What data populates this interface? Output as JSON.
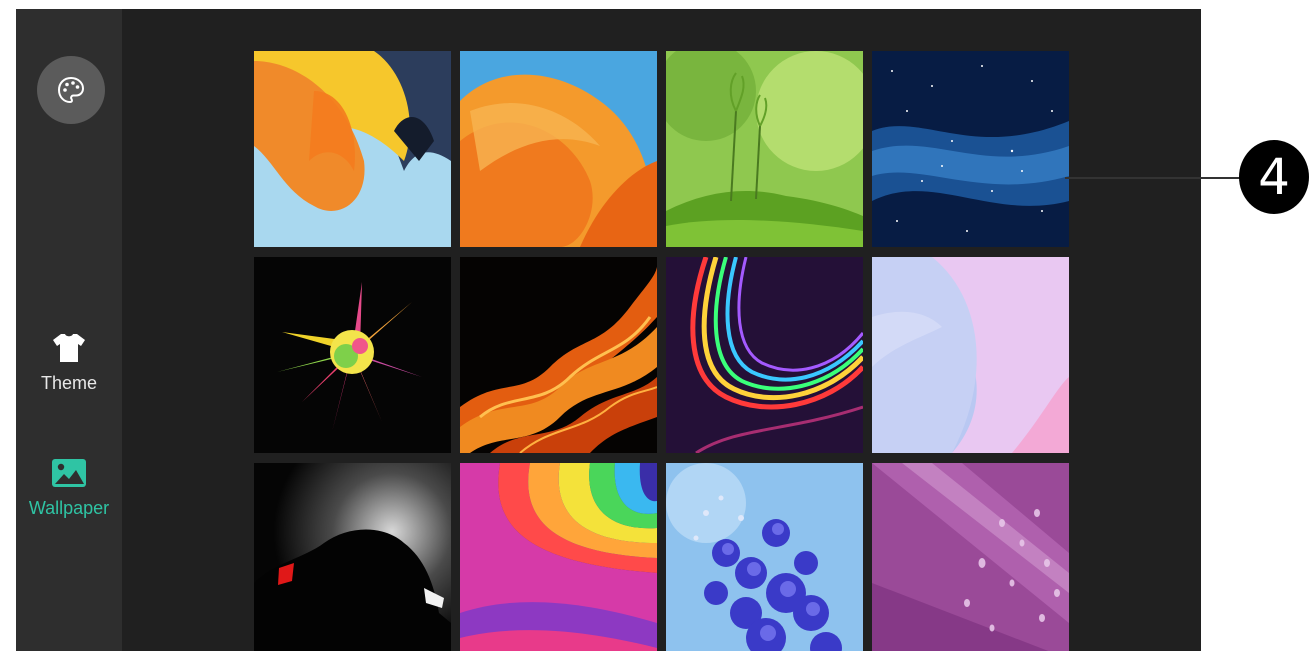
{
  "sidebar": {
    "palette_button": {
      "icon": "palette-icon"
    },
    "items": [
      {
        "label": "Theme",
        "icon": "tshirt-icon",
        "active": false
      },
      {
        "label": "Wallpaper",
        "icon": "image-icon",
        "active": true,
        "color": "#2fc4a4"
      }
    ]
  },
  "wallpapers": [
    {
      "name": "wallpaper-orange-yellow-fold",
      "row": 1,
      "col": 1
    },
    {
      "name": "wallpaper-orange-petals",
      "row": 1,
      "col": 2
    },
    {
      "name": "wallpaper-green-sprouts",
      "row": 1,
      "col": 3
    },
    {
      "name": "wallpaper-blue-starfield",
      "row": 1,
      "col": 4
    },
    {
      "name": "wallpaper-color-powder-burst",
      "row": 2,
      "col": 1
    },
    {
      "name": "wallpaper-flames",
      "row": 2,
      "col": 2
    },
    {
      "name": "wallpaper-light-streaks",
      "row": 2,
      "col": 3
    },
    {
      "name": "wallpaper-pastel-curves",
      "row": 2,
      "col": 4
    },
    {
      "name": "wallpaper-dark-car-silhouette",
      "row": 3,
      "col": 1
    },
    {
      "name": "wallpaper-rainbow-waves",
      "row": 3,
      "col": 2
    },
    {
      "name": "wallpaper-blue-flowers",
      "row": 3,
      "col": 3
    },
    {
      "name": "wallpaper-purple-water-drops",
      "row": 3,
      "col": 4
    }
  ],
  "callout": {
    "number": "4"
  }
}
